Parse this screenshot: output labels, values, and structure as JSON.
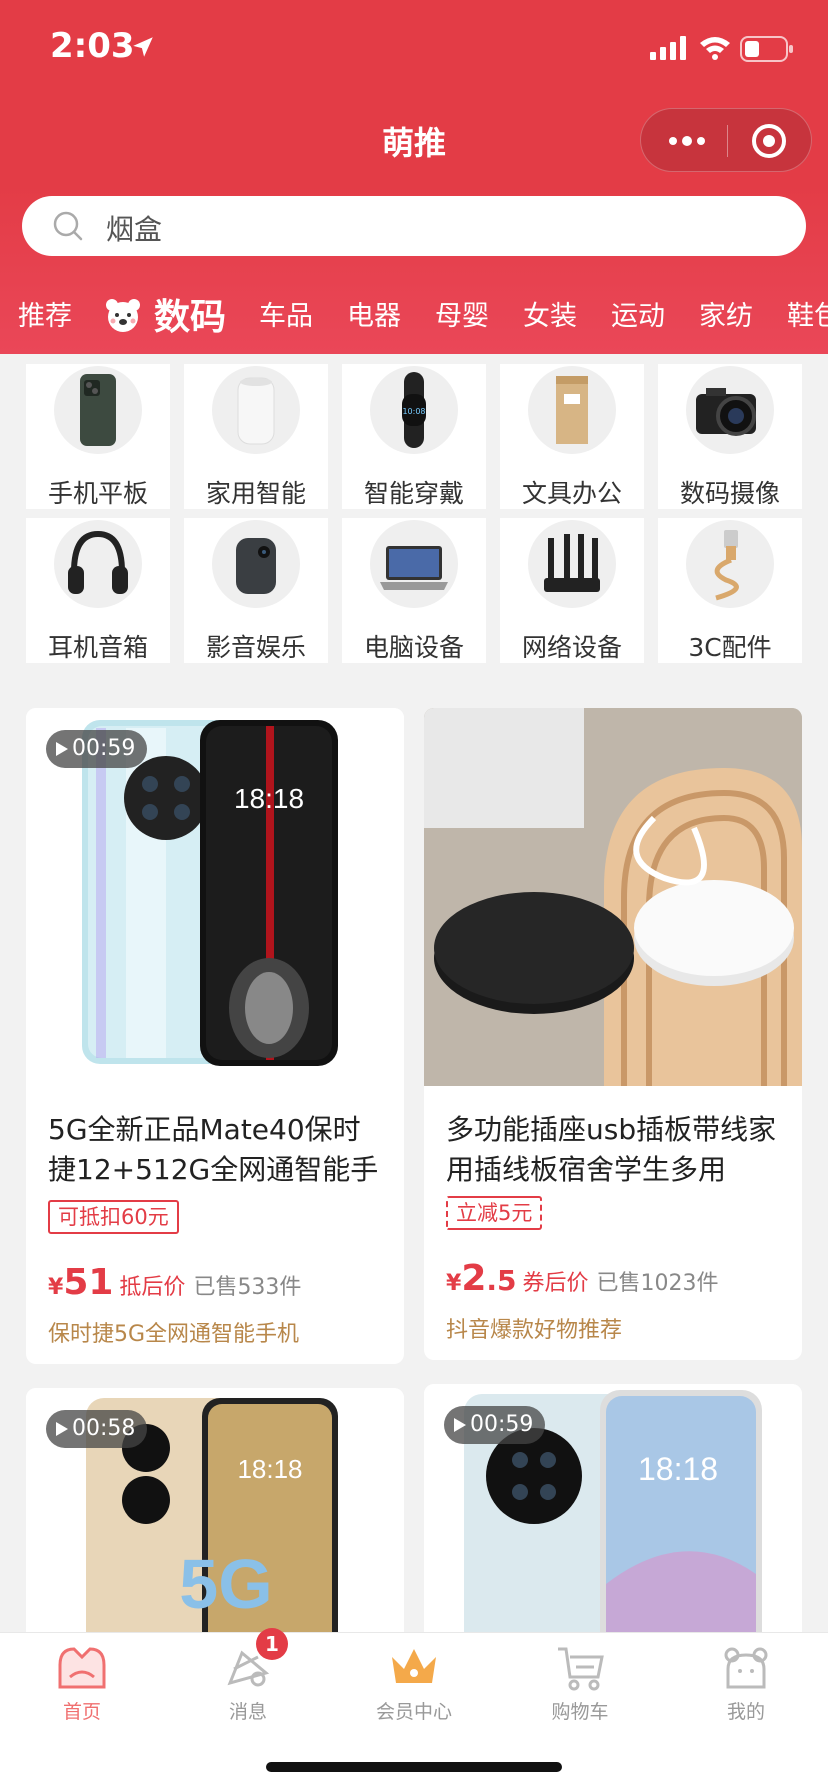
{
  "status_bar": {
    "time": "2:03"
  },
  "nav": {
    "title": "萌推"
  },
  "search": {
    "placeholder": "烟盒"
  },
  "categories": [
    "推荐",
    "数码",
    "车品",
    "电器",
    "母婴",
    "女装",
    "运动",
    "家纺",
    "鞋包"
  ],
  "active_category": "数码",
  "subcategories": [
    {
      "label": "手机平板",
      "icon": "phone-icon"
    },
    {
      "label": "家用智能",
      "icon": "smart-speaker-icon"
    },
    {
      "label": "智能穿戴",
      "icon": "smart-band-icon"
    },
    {
      "label": "文具办公",
      "icon": "paper-bag-icon"
    },
    {
      "label": "数码摄像",
      "icon": "camera-icon"
    },
    {
      "label": "耳机音箱",
      "icon": "headphones-icon"
    },
    {
      "label": "影音娱乐",
      "icon": "projector-icon"
    },
    {
      "label": "电脑设备",
      "icon": "laptop-icon"
    },
    {
      "label": "网络设备",
      "icon": "router-icon"
    },
    {
      "label": "3C配件",
      "icon": "cable-icon"
    }
  ],
  "products": [
    {
      "video_duration": "00:59",
      "title": "5G全新正品Mate40保时捷12+512G全网通智能手",
      "tag": "可抵扣60元",
      "price_yen": "¥",
      "price_int": "51",
      "price_dec": "",
      "price_label": "抵后价",
      "sold": "已售533件",
      "desc": "保时捷5G全网通智能手机"
    },
    {
      "video_duration": "",
      "title": "多功能插座usb插板带线家用插线板宿舍学生多用",
      "tag": "立减5元",
      "price_yen": "¥",
      "price_int": "2",
      "price_dec": ".5",
      "price_label": "券后价",
      "sold": "已售1023件",
      "desc": "抖音爆款好物推荐"
    },
    {
      "video_duration": "00:58"
    },
    {
      "video_duration": "00:59"
    }
  ],
  "tabbar": [
    {
      "label": "首页",
      "icon": "home-icon"
    },
    {
      "label": "消息",
      "icon": "message-icon"
    },
    {
      "label": "会员中心",
      "icon": "crown-icon"
    },
    {
      "label": "购物车",
      "icon": "cart-icon"
    },
    {
      "label": "我的",
      "icon": "profile-icon"
    }
  ],
  "message_badge": "1",
  "colors": {
    "brand": "#e33c46",
    "desc": "#b8874a",
    "active_tab": "#f07070"
  }
}
